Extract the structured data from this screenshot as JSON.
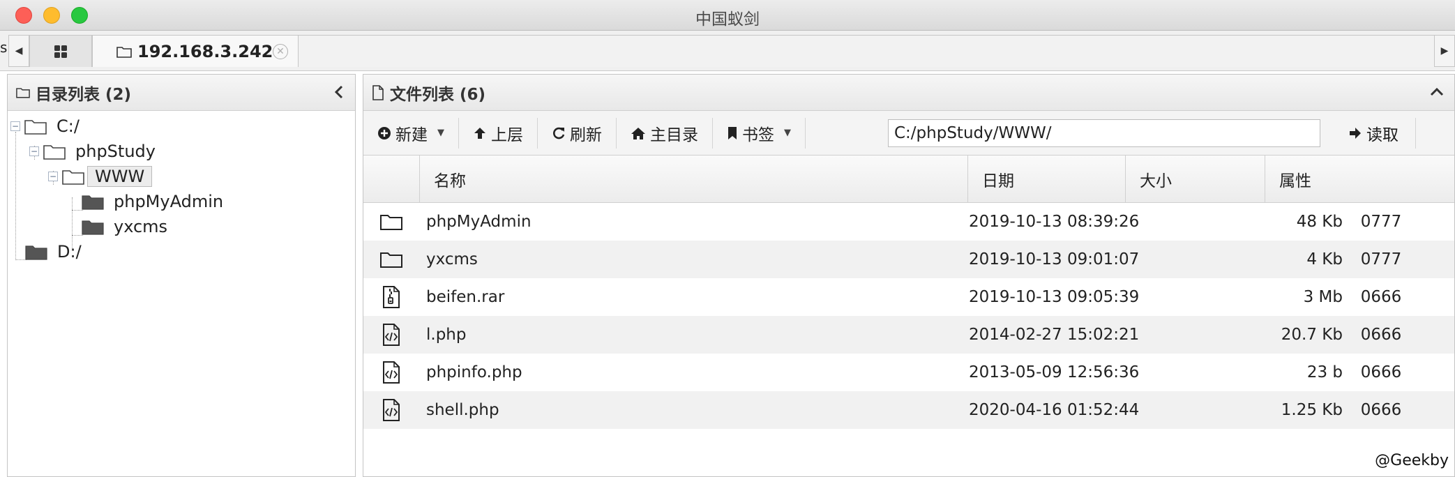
{
  "window": {
    "title": "中国蚁剑"
  },
  "tabs": {
    "edge_glyph": "s",
    "host_label": "192.168.3.242"
  },
  "left_panel": {
    "title": "目录列表 (2)",
    "tree": [
      {
        "label": "C:/"
      },
      {
        "label": "phpStudy"
      },
      {
        "label": "WWW"
      },
      {
        "label": "phpMyAdmin"
      },
      {
        "label": "yxcms"
      },
      {
        "label": "D:/"
      }
    ]
  },
  "right_panel": {
    "title": "文件列表 (6)",
    "toolbar": {
      "new_label": "新建",
      "up_label": "上层",
      "refresh_label": "刷新",
      "home_label": "主目录",
      "bookmark_label": "书签",
      "path_value": "C:/phpStudy/WWW/",
      "read_label": "读取"
    },
    "columns": {
      "name": "名称",
      "date": "日期",
      "size": "大小",
      "attr": "属性"
    },
    "rows": [
      {
        "icon": "folder-icon",
        "name": "phpMyAdmin",
        "date": "2019-10-13 08:39:26",
        "size": "48 Kb",
        "attr": "0777"
      },
      {
        "icon": "folder-icon",
        "name": "yxcms",
        "date": "2019-10-13 09:01:07",
        "size": "4 Kb",
        "attr": "0777"
      },
      {
        "icon": "archive-file-icon",
        "name": "beifen.rar",
        "date": "2019-10-13 09:05:39",
        "size": "3 Mb",
        "attr": "0666"
      },
      {
        "icon": "code-file-icon",
        "name": "l.php",
        "date": "2014-02-27 15:02:21",
        "size": "20.7 Kb",
        "attr": "0666"
      },
      {
        "icon": "code-file-icon",
        "name": "phpinfo.php",
        "date": "2013-05-09 12:56:36",
        "size": "23 b",
        "attr": "0666"
      },
      {
        "icon": "code-file-icon",
        "name": "shell.php",
        "date": "2020-04-16 01:52:44",
        "size": "1.25 Kb",
        "attr": "0666"
      }
    ]
  },
  "watermark": "@Geekby"
}
